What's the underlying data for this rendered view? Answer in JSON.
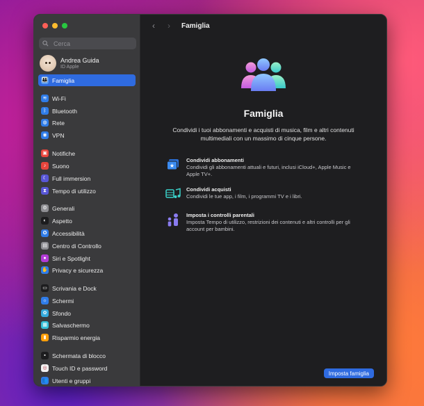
{
  "search": {
    "placeholder": "Cerca"
  },
  "profile": {
    "name": "Andrea Guida",
    "subtitle": "ID Apple"
  },
  "sidebar": {
    "items": [
      {
        "label": "Famiglia",
        "icon": "family-icon",
        "color": "#5a9cf0",
        "glyph": "👪"
      },
      {
        "label": "Wi-Fi",
        "icon": "wifi-icon",
        "color": "#2f7ce8",
        "glyph": "≋"
      },
      {
        "label": "Bluetooth",
        "icon": "bluetooth-icon",
        "color": "#2f7ce8",
        "glyph": "ᛒ"
      },
      {
        "label": "Rete",
        "icon": "network-icon",
        "color": "#2f7ce8",
        "glyph": "◍"
      },
      {
        "label": "VPN",
        "icon": "vpn-icon",
        "color": "#2f7ce8",
        "glyph": "◉"
      },
      {
        "label": "Notifiche",
        "icon": "notifications-icon",
        "color": "#e8453c",
        "glyph": "▣"
      },
      {
        "label": "Suono",
        "icon": "sound-icon",
        "color": "#e8453c",
        "glyph": "♪"
      },
      {
        "label": "Full immersion",
        "icon": "focus-icon",
        "color": "#5856d6",
        "glyph": "☾"
      },
      {
        "label": "Tempo di utilizzo",
        "icon": "screen-time-icon",
        "color": "#5856d6",
        "glyph": "⧗"
      },
      {
        "label": "Generali",
        "icon": "general-icon",
        "color": "#8e8e93",
        "glyph": "⚙"
      },
      {
        "label": "Aspetto",
        "icon": "appearance-icon",
        "color": "#1c1c1e",
        "glyph": "◐"
      },
      {
        "label": "Accessibilità",
        "icon": "accessibility-icon",
        "color": "#2f7ce8",
        "glyph": "✪"
      },
      {
        "label": "Centro di Controllo",
        "icon": "control-center-icon",
        "color": "#8e8e93",
        "glyph": "▤"
      },
      {
        "label": "Siri e Spotlight",
        "icon": "siri-icon",
        "color": "#b23ad6",
        "glyph": "●"
      },
      {
        "label": "Privacy e sicurezza",
        "icon": "privacy-icon",
        "color": "#2f7ce8",
        "glyph": "✋"
      },
      {
        "label": "Scrivania e Dock",
        "icon": "desktop-dock-icon",
        "color": "#1c1c1e",
        "glyph": "▭"
      },
      {
        "label": "Schermi",
        "icon": "displays-icon",
        "color": "#2f7ce8",
        "glyph": "☼"
      },
      {
        "label": "Sfondo",
        "icon": "wallpaper-icon",
        "color": "#34aadc",
        "glyph": "✿"
      },
      {
        "label": "Salvaschermo",
        "icon": "screensaver-icon",
        "color": "#34c0d8",
        "glyph": "▦"
      },
      {
        "label": "Risparmio energia",
        "icon": "energy-icon",
        "color": "#ff9f0a",
        "glyph": "▮"
      },
      {
        "label": "Schermata di blocco",
        "icon": "lock-screen-icon",
        "color": "#1c1c1e",
        "glyph": "▪"
      },
      {
        "label": "Touch ID e password",
        "icon": "touch-id-icon",
        "color": "#f2f2f2",
        "glyph": "◎"
      },
      {
        "label": "Utenti e gruppi",
        "icon": "users-icon",
        "color": "#2f7ce8",
        "glyph": "👥"
      }
    ]
  },
  "toolbar": {
    "title": "Famiglia",
    "back": "‹",
    "forward": "›"
  },
  "main": {
    "heading": "Famiglia",
    "description": "Condividi i tuoi abbonamenti e acquisti di musica, film e altri contenuti multimediali con un massimo di cinque persone.",
    "features": [
      {
        "title": "Condividi abbonamenti",
        "text": "Condividi gli abbonamenti attuali e futuri, inclusi iCloud+, Apple Music e Apple TV+."
      },
      {
        "title": "Condividi acquisti",
        "text": "Condividi le tue app, i film, i programmi TV e i libri."
      },
      {
        "title": "Imposta i controlli parentali",
        "text": "Imposta Tempo di utilizzo, restrizioni dei contenuti e altri controlli per gli account per bambini."
      }
    ],
    "setup_button": "Imposta famiglia"
  },
  "colors": {
    "accent": "#2f6be0",
    "sidebar_bg": "#3a3a3c",
    "content_bg": "#1e1e20"
  }
}
